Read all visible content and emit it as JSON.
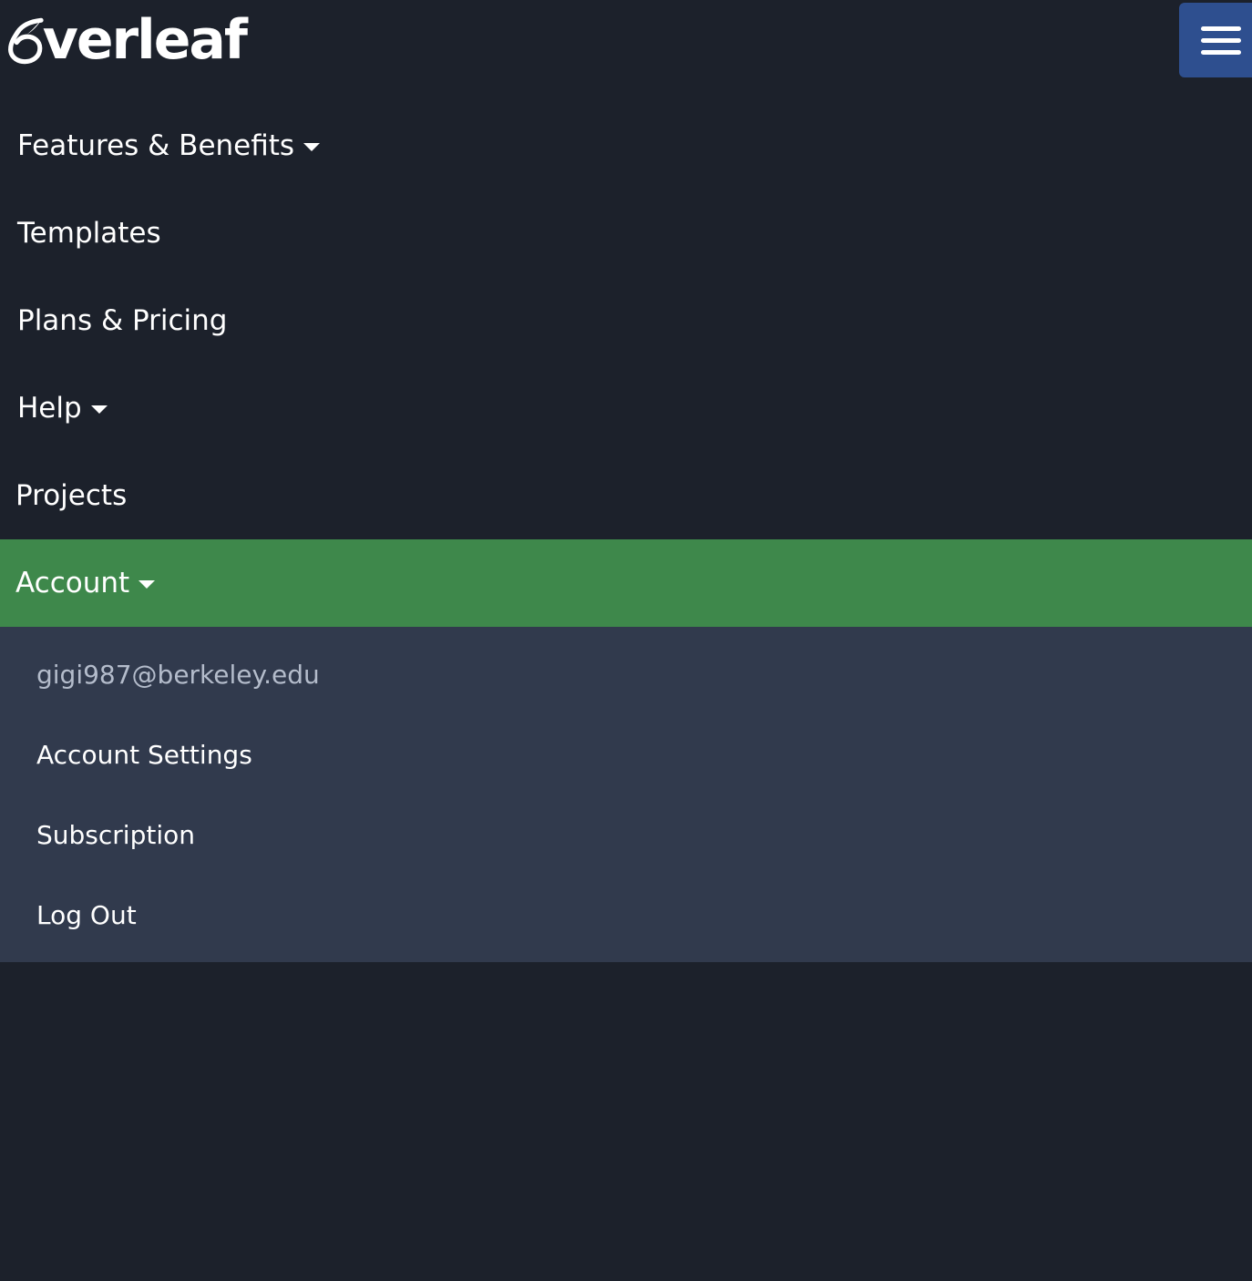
{
  "header": {
    "logo_text": "verleaf",
    "logo_alt": "Overleaf",
    "menu_toggle_icon": "hamburger-icon"
  },
  "nav": {
    "items": [
      {
        "label": "Features & Benefits",
        "has_caret": true
      },
      {
        "label": "Templates",
        "has_caret": false
      },
      {
        "label": "Plans & Pricing",
        "has_caret": false
      },
      {
        "label": "Help",
        "has_caret": true
      },
      {
        "label": "Projects",
        "has_caret": false
      },
      {
        "label": "Account",
        "has_caret": true,
        "active": true
      }
    ]
  },
  "account_dropdown": {
    "email": "gigi987@berkeley.edu",
    "items": [
      {
        "label": "Account Settings"
      },
      {
        "label": "Subscription"
      },
      {
        "label": "Log Out"
      }
    ]
  },
  "colors": {
    "background": "#1c212b",
    "active_item": "#3e884b",
    "dropdown_bg": "#313a4d",
    "toggle_bg": "#2e4f8f",
    "email_text": "#b4bccb"
  }
}
